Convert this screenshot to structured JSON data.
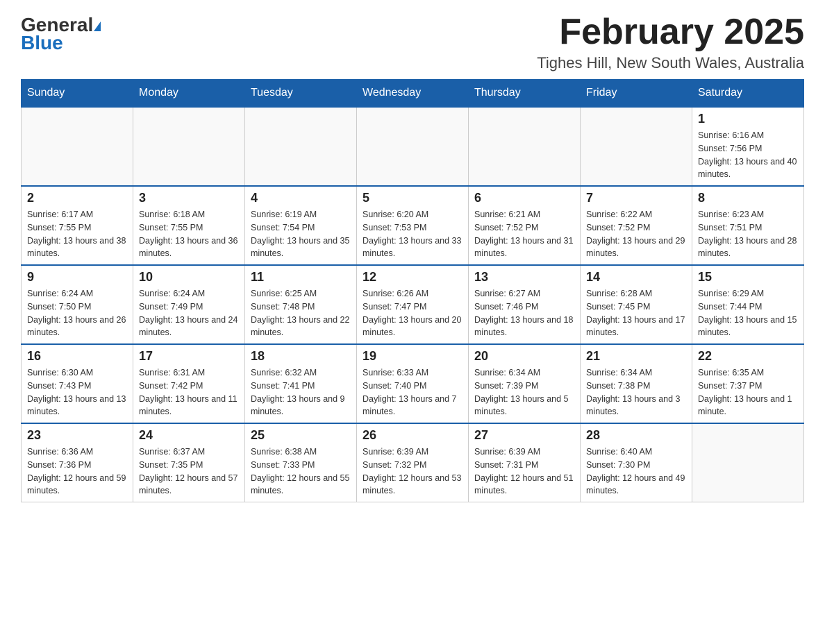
{
  "header": {
    "logo_general": "General",
    "logo_blue": "Blue",
    "month_title": "February 2025",
    "location": "Tighes Hill, New South Wales, Australia"
  },
  "weekdays": [
    "Sunday",
    "Monday",
    "Tuesday",
    "Wednesday",
    "Thursday",
    "Friday",
    "Saturday"
  ],
  "weeks": [
    {
      "days": [
        {
          "num": "",
          "info": ""
        },
        {
          "num": "",
          "info": ""
        },
        {
          "num": "",
          "info": ""
        },
        {
          "num": "",
          "info": ""
        },
        {
          "num": "",
          "info": ""
        },
        {
          "num": "",
          "info": ""
        },
        {
          "num": "1",
          "info": "Sunrise: 6:16 AM\nSunset: 7:56 PM\nDaylight: 13 hours and 40 minutes."
        }
      ]
    },
    {
      "days": [
        {
          "num": "2",
          "info": "Sunrise: 6:17 AM\nSunset: 7:55 PM\nDaylight: 13 hours and 38 minutes."
        },
        {
          "num": "3",
          "info": "Sunrise: 6:18 AM\nSunset: 7:55 PM\nDaylight: 13 hours and 36 minutes."
        },
        {
          "num": "4",
          "info": "Sunrise: 6:19 AM\nSunset: 7:54 PM\nDaylight: 13 hours and 35 minutes."
        },
        {
          "num": "5",
          "info": "Sunrise: 6:20 AM\nSunset: 7:53 PM\nDaylight: 13 hours and 33 minutes."
        },
        {
          "num": "6",
          "info": "Sunrise: 6:21 AM\nSunset: 7:52 PM\nDaylight: 13 hours and 31 minutes."
        },
        {
          "num": "7",
          "info": "Sunrise: 6:22 AM\nSunset: 7:52 PM\nDaylight: 13 hours and 29 minutes."
        },
        {
          "num": "8",
          "info": "Sunrise: 6:23 AM\nSunset: 7:51 PM\nDaylight: 13 hours and 28 minutes."
        }
      ]
    },
    {
      "days": [
        {
          "num": "9",
          "info": "Sunrise: 6:24 AM\nSunset: 7:50 PM\nDaylight: 13 hours and 26 minutes."
        },
        {
          "num": "10",
          "info": "Sunrise: 6:24 AM\nSunset: 7:49 PM\nDaylight: 13 hours and 24 minutes."
        },
        {
          "num": "11",
          "info": "Sunrise: 6:25 AM\nSunset: 7:48 PM\nDaylight: 13 hours and 22 minutes."
        },
        {
          "num": "12",
          "info": "Sunrise: 6:26 AM\nSunset: 7:47 PM\nDaylight: 13 hours and 20 minutes."
        },
        {
          "num": "13",
          "info": "Sunrise: 6:27 AM\nSunset: 7:46 PM\nDaylight: 13 hours and 18 minutes."
        },
        {
          "num": "14",
          "info": "Sunrise: 6:28 AM\nSunset: 7:45 PM\nDaylight: 13 hours and 17 minutes."
        },
        {
          "num": "15",
          "info": "Sunrise: 6:29 AM\nSunset: 7:44 PM\nDaylight: 13 hours and 15 minutes."
        }
      ]
    },
    {
      "days": [
        {
          "num": "16",
          "info": "Sunrise: 6:30 AM\nSunset: 7:43 PM\nDaylight: 13 hours and 13 minutes."
        },
        {
          "num": "17",
          "info": "Sunrise: 6:31 AM\nSunset: 7:42 PM\nDaylight: 13 hours and 11 minutes."
        },
        {
          "num": "18",
          "info": "Sunrise: 6:32 AM\nSunset: 7:41 PM\nDaylight: 13 hours and 9 minutes."
        },
        {
          "num": "19",
          "info": "Sunrise: 6:33 AM\nSunset: 7:40 PM\nDaylight: 13 hours and 7 minutes."
        },
        {
          "num": "20",
          "info": "Sunrise: 6:34 AM\nSunset: 7:39 PM\nDaylight: 13 hours and 5 minutes."
        },
        {
          "num": "21",
          "info": "Sunrise: 6:34 AM\nSunset: 7:38 PM\nDaylight: 13 hours and 3 minutes."
        },
        {
          "num": "22",
          "info": "Sunrise: 6:35 AM\nSunset: 7:37 PM\nDaylight: 13 hours and 1 minute."
        }
      ]
    },
    {
      "days": [
        {
          "num": "23",
          "info": "Sunrise: 6:36 AM\nSunset: 7:36 PM\nDaylight: 12 hours and 59 minutes."
        },
        {
          "num": "24",
          "info": "Sunrise: 6:37 AM\nSunset: 7:35 PM\nDaylight: 12 hours and 57 minutes."
        },
        {
          "num": "25",
          "info": "Sunrise: 6:38 AM\nSunset: 7:33 PM\nDaylight: 12 hours and 55 minutes."
        },
        {
          "num": "26",
          "info": "Sunrise: 6:39 AM\nSunset: 7:32 PM\nDaylight: 12 hours and 53 minutes."
        },
        {
          "num": "27",
          "info": "Sunrise: 6:39 AM\nSunset: 7:31 PM\nDaylight: 12 hours and 51 minutes."
        },
        {
          "num": "28",
          "info": "Sunrise: 6:40 AM\nSunset: 7:30 PM\nDaylight: 12 hours and 49 minutes."
        },
        {
          "num": "",
          "info": ""
        }
      ]
    }
  ]
}
